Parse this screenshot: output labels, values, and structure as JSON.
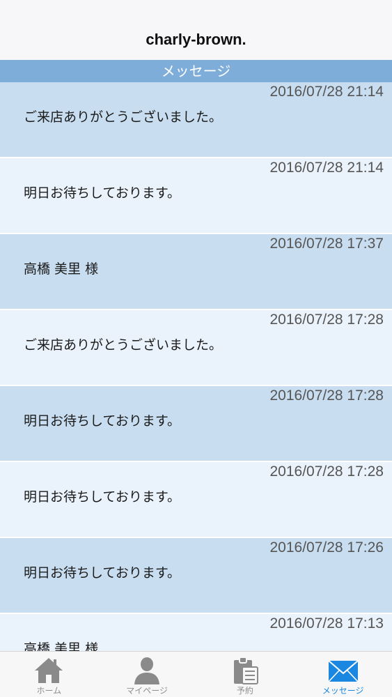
{
  "header": {
    "title": "charly-brown."
  },
  "section": {
    "title": "メッセージ"
  },
  "messages": [
    {
      "timestamp": "2016/07/28 21:14",
      "text": "ご来店ありがとうございました。"
    },
    {
      "timestamp": "2016/07/28 21:14",
      "text": "明日お待ちしております。"
    },
    {
      "timestamp": "2016/07/28 17:37",
      "text": "高橋 美里 様"
    },
    {
      "timestamp": "2016/07/28 17:28",
      "text": "ご来店ありがとうございました。"
    },
    {
      "timestamp": "2016/07/28 17:28",
      "text": "明日お待ちしております。"
    },
    {
      "timestamp": "2016/07/28 17:28",
      "text": "明日お待ちしております。"
    },
    {
      "timestamp": "2016/07/28 17:26",
      "text": "明日お待ちしております。"
    },
    {
      "timestamp": "2016/07/28 17:13",
      "text": "高橋 美里 様"
    }
  ],
  "tabbar": {
    "tabs": [
      {
        "label": "ホーム",
        "icon": "home-icon"
      },
      {
        "label": "マイページ",
        "icon": "person-icon"
      },
      {
        "label": "予約",
        "icon": "clipboard-icon"
      },
      {
        "label": "メッセージ",
        "icon": "envelope-icon"
      }
    ],
    "active_index": 3
  },
  "colors": {
    "section_bar": "#7fadda",
    "row_dark": "#c8ddf0",
    "row_light": "#eaf2fb",
    "active_tab": "#1a88e0",
    "inactive_tab": "#8e8e8e"
  }
}
